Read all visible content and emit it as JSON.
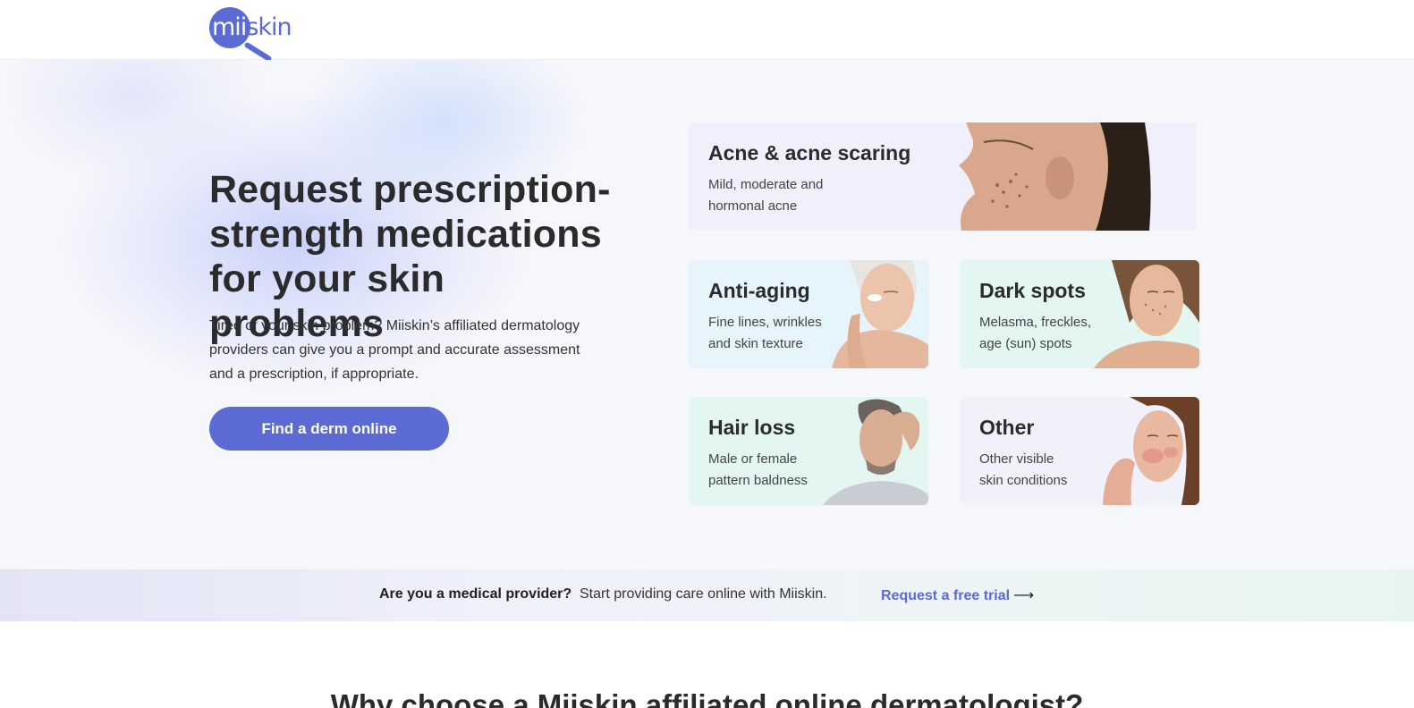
{
  "header": {
    "logo": {
      "text_part1": "mii",
      "text_part2": "skin"
    }
  },
  "hero": {
    "title_line1": "Request prescription-",
    "title_line2": "strength medications",
    "title_line3": "for your skin problems",
    "description": "Tired of your skin problem? Miiskin’s affiliated dermatology providers can give you a prompt and accurate assessment and a prescription, if appropriate.",
    "cta_label": "Find a derm online"
  },
  "conditions": [
    {
      "title": "Acne & acne scaring",
      "desc_line1": "Mild, moderate and",
      "desc_line2": "hormonal acne"
    },
    {
      "title": "Anti-aging",
      "desc_line1": "Fine lines, wrinkles",
      "desc_line2": "and skin texture"
    },
    {
      "title": "Dark spots",
      "desc_line1": "Melasma, freckles,",
      "desc_line2": "age (sun) spots"
    },
    {
      "title": "Hair loss",
      "desc_line1": "Male or female",
      "desc_line2": "pattern baldness"
    },
    {
      "title": "Other",
      "desc_line1": "Other visible",
      "desc_line2": "skin conditions"
    }
  ],
  "provider_banner": {
    "bold_text": "Are you a medical provider?",
    "text": "Start providing care online with Miiskin.",
    "link_label": "Request a free trial",
    "link_arrow": "⟶"
  },
  "why_section": {
    "title": "Why choose a Miiskin affiliated online dermatologist?"
  },
  "colors": {
    "brand": "#5c6bd3",
    "hero_bg": "#f6f7fb",
    "card_lavender": "#eff0fb",
    "card_blue": "#e6f4fb",
    "card_mint": "#e3f6f1"
  }
}
